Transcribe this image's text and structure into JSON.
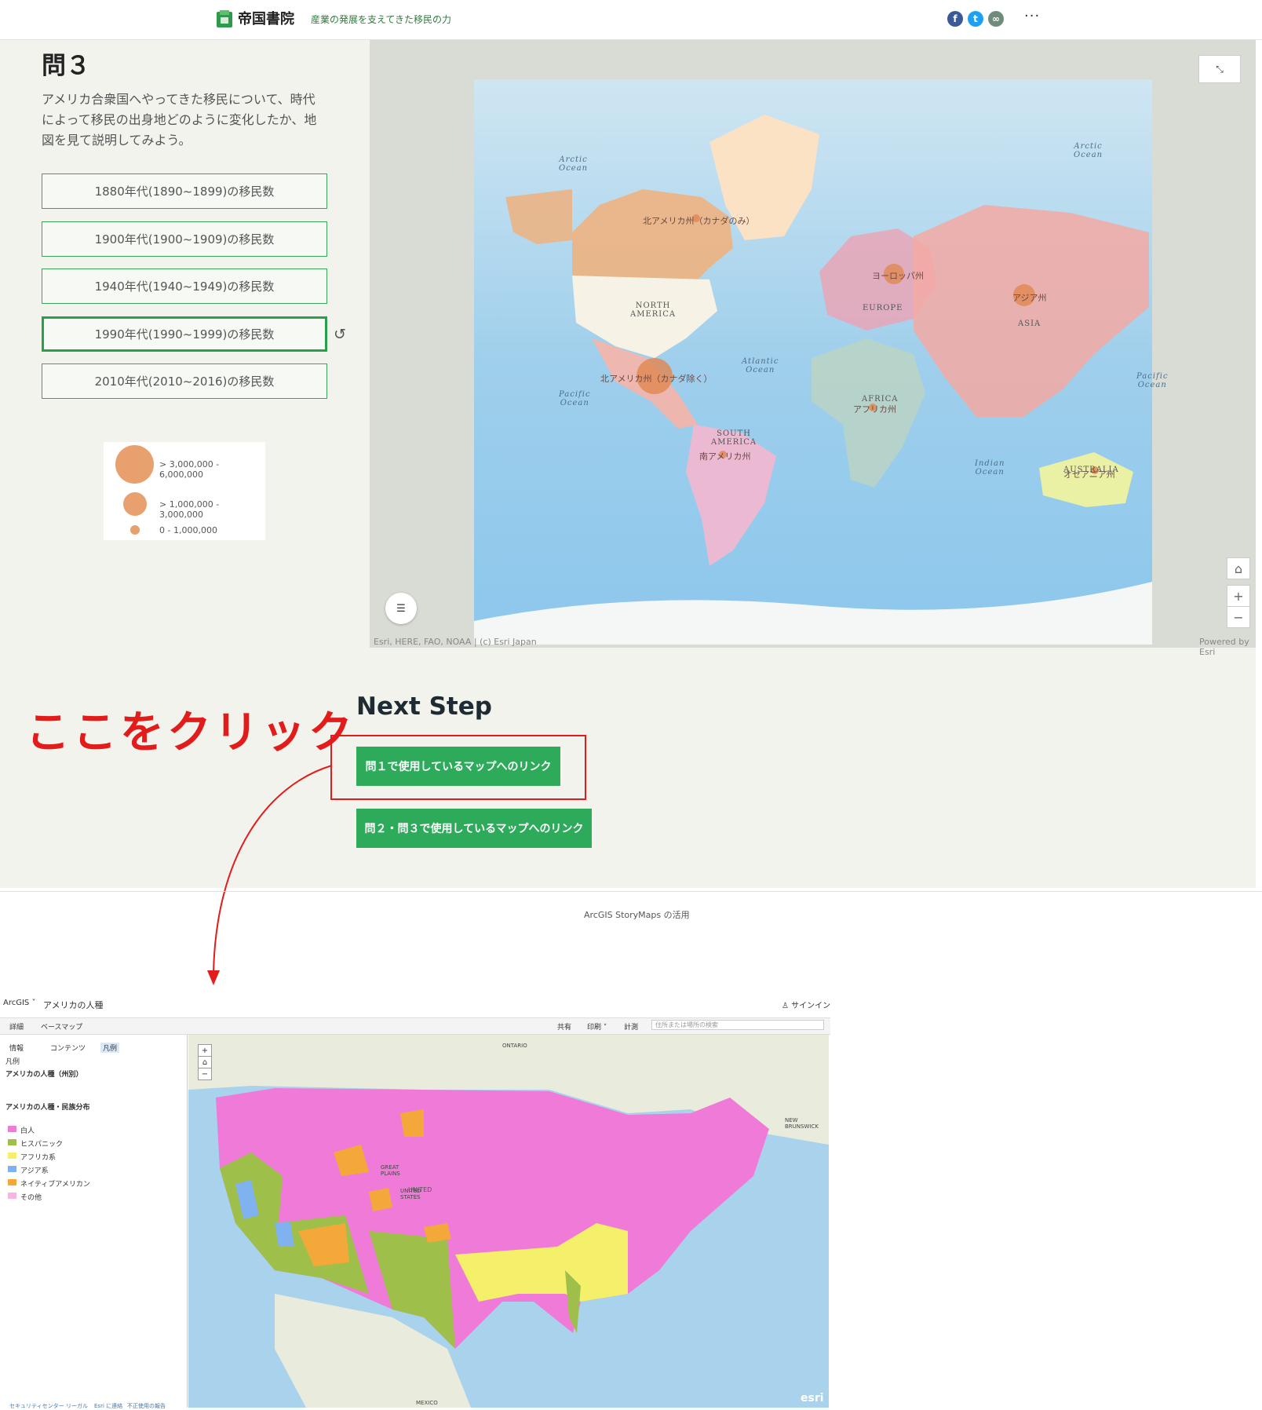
{
  "header": {
    "brand": "帝国書院",
    "tagline": "産業の発展を支えてきた移民の力",
    "social": {
      "facebook": "f",
      "twitter": "t",
      "link": "∞"
    },
    "more": "···"
  },
  "question": {
    "title": "問３",
    "text": "アメリカ合衆国へやってきた移民について、時代によって移民の出身地どのように変化したか、地図を見て説明してみよう。",
    "options": [
      {
        "label": "1880年代(1890~1899)の移民数"
      },
      {
        "label": "1900年代(1900~1909)の移民数"
      },
      {
        "label": "1940年代(1940~1949)の移民数"
      },
      {
        "label": "1990年代(1990~1999)の移民数"
      },
      {
        "label": "2010年代(2010~2016)の移民数"
      }
    ],
    "selected_index": 3,
    "reset_icon": "↺"
  },
  "legend": {
    "items": [
      {
        "label": "> 3,000,000 - 6,000,000"
      },
      {
        "label": "> 1,000,000 - 3,000,000"
      },
      {
        "label": "0 - 1,000,000"
      }
    ]
  },
  "map": {
    "labels": {
      "arctic_left": "Arctic\nOcean",
      "arctic_right": "Arctic\nOcean",
      "north_america": "NORTH\nAMERICA",
      "europe": "EUROPE",
      "asia": "ASIA",
      "africa": "AFRICA",
      "south_america": "SOUTH\nAMERICA",
      "australia": "AUSTRALIA",
      "atlantic": "Atlantic\nOcean",
      "pacific_left": "Pacific\nOcean",
      "pacific_right": "Pacific\nOcean",
      "indian": "Indian\nOcean",
      "na_canada": "北アメリカ州（カナダのみ）",
      "na_excl": "北アメリカ州（カナダ除く）",
      "europe_jp": "ヨーロッパ州",
      "asia_jp": "アジア州",
      "africa_jp": "アフリカ州",
      "sa_jp": "南アメリカ州",
      "oceania_jp": "オセアニア州"
    },
    "attribution": "Esri, HERE, FAO, NOAA | (c) Esri Japan",
    "powered": "Powered by Esri",
    "expand_icon": "⤡",
    "legend_icon": "☰",
    "home_icon": "⌂",
    "zoom_in": "+",
    "zoom_out": "−"
  },
  "next_step": {
    "title": "Next Step",
    "link1": "問１で使用しているマップへのリンク",
    "link2": "問２・問３で使用しているマップへのリンク"
  },
  "annotation": {
    "click_here": "ここをクリック",
    "color": "#e21b1b"
  },
  "footer": {
    "text": "ArcGIS StoryMaps の活用"
  },
  "arcgis": {
    "brand": "ArcGIS ˅",
    "title": "アメリカの人種",
    "signin": "♙ サインイン",
    "toolbar_left": [
      "詳細",
      "ベースマップ"
    ],
    "toolbar_right": [
      "共有",
      "印刷 ˅",
      "計測"
    ],
    "search_placeholder": "住所または場所の検索",
    "side_tabs": [
      "情報",
      "コンテンツ",
      "凡例"
    ],
    "legend_heading": "凡例",
    "layer1": "アメリカの人種（州別）",
    "layer2": "アメリカの人種・民族分布",
    "categories": [
      {
        "label": "白人",
        "color": "#f07ad8"
      },
      {
        "label": "ヒスパニック",
        "color": "#9ec04a"
      },
      {
        "label": "アフリカ系",
        "color": "#f5f06a"
      },
      {
        "label": "アジア系",
        "color": "#7fb2ef"
      },
      {
        "label": "ネイティブアメリカン",
        "color": "#f5a83a"
      },
      {
        "label": "その他",
        "color": "#f7b6e0"
      }
    ],
    "bottom_links": [
      "セキュリティセンター",
      "リーガル",
      "Esri に連絡",
      "不正使用の報告"
    ],
    "map_labels": {
      "ontario": "ONTARIO",
      "united_states": "UNITED\nSTATES",
      "mexico": "MEXICO",
      "great_plains": "GREAT\nPLAINS",
      "new_brunswick": "NEW\nBRUNSWICK"
    },
    "esri": "esri"
  }
}
